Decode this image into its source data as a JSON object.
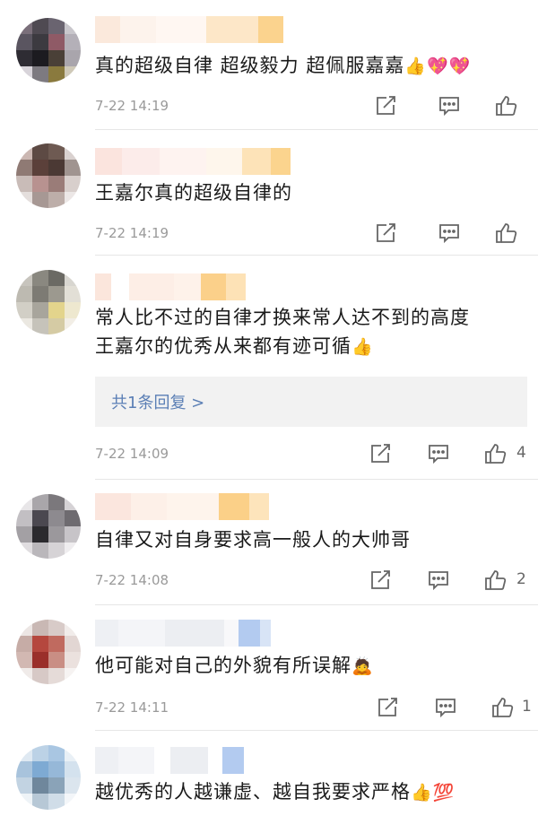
{
  "comments": [
    {
      "text": "真的超级自律 超级毅力 超佩服嘉嘉",
      "emojis": "👍💖💖",
      "time": "7-22 14:19",
      "likes": ""
    },
    {
      "text": "王嘉尔真的超级自律的",
      "emojis": "",
      "time": "7-22 14:19",
      "likes": ""
    },
    {
      "text_line1": "常人比不过的自律才换来常人达不到的高度",
      "text_line2": "王嘉尔的优秀从来都有迹可循",
      "emojis": "👍",
      "reply_link": "共1条回复 >",
      "time": "7-22 14:09",
      "likes": "4"
    },
    {
      "text": "自律又对自身要求高一般人的大帅哥",
      "emojis": "",
      "time": "7-22 14:08",
      "likes": "2"
    },
    {
      "text": "他可能对自己的外貌有所误解",
      "emojis": "🙇",
      "time": "7-22 14:11",
      "likes": "1"
    },
    {
      "text": "越优秀的人越谦虚、越自我要求严格",
      "emojis": "👍💯",
      "time": "",
      "likes": ""
    }
  ],
  "icons": {
    "repost": "repost-icon",
    "comment": "comment-icon",
    "like": "thumbs-up-icon"
  },
  "colors": {
    "text": "#1a1a1a",
    "meta": "#9a9a9a",
    "link": "#5b7fb5",
    "reply_bg": "#f2f2f2"
  }
}
